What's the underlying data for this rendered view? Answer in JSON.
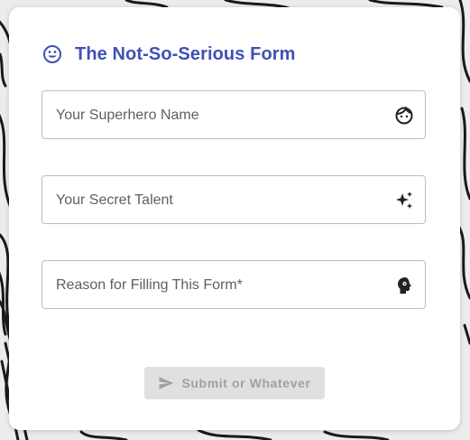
{
  "form": {
    "title": "The Not-So-Serious Form",
    "title_icon": "smiley-face-icon",
    "accent_color": "#3f51b5",
    "fields": [
      {
        "label": "Your Superhero Name",
        "value": "",
        "icon": "face-icon"
      },
      {
        "label": "Your Secret Talent",
        "value": "",
        "icon": "sparkles-icon"
      },
      {
        "label": "Reason for Filling This Form*",
        "value": "",
        "icon": "psychology-head-icon"
      }
    ],
    "submit": {
      "label": "Submit or Whatever",
      "icon": "send-icon",
      "disabled": true
    }
  }
}
